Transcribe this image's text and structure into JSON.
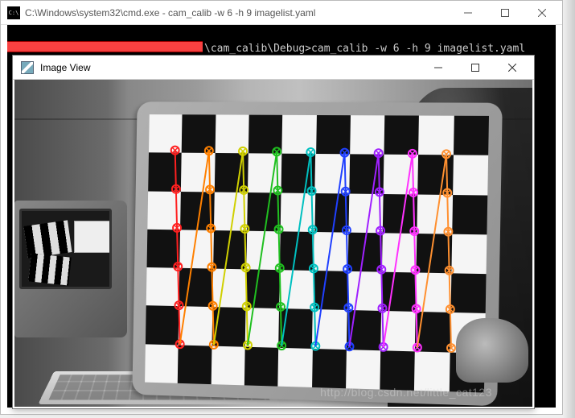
{
  "cmd": {
    "title": "C:\\Windows\\system32\\cmd.exe - cam_calib  -w 6 -h 9 imagelist.yaml",
    "prompt_suffix": "\\cam_calib\\Debug>cam_calib -w 6 -h 9 imagelist.yaml"
  },
  "image_view": {
    "title": "Image View"
  },
  "watermark": "http://blog.csdn.net/little_cat123",
  "calibration": {
    "checker_rows": 7,
    "checker_cols": 10,
    "corner_rows": 6,
    "corner_cols": 9,
    "column_colors": [
      "#ff2020",
      "#ff8000",
      "#d0d000",
      "#20c020",
      "#00c0c0",
      "#2040ff",
      "#a020ff",
      "#ff30ff",
      "#ff9030"
    ]
  }
}
